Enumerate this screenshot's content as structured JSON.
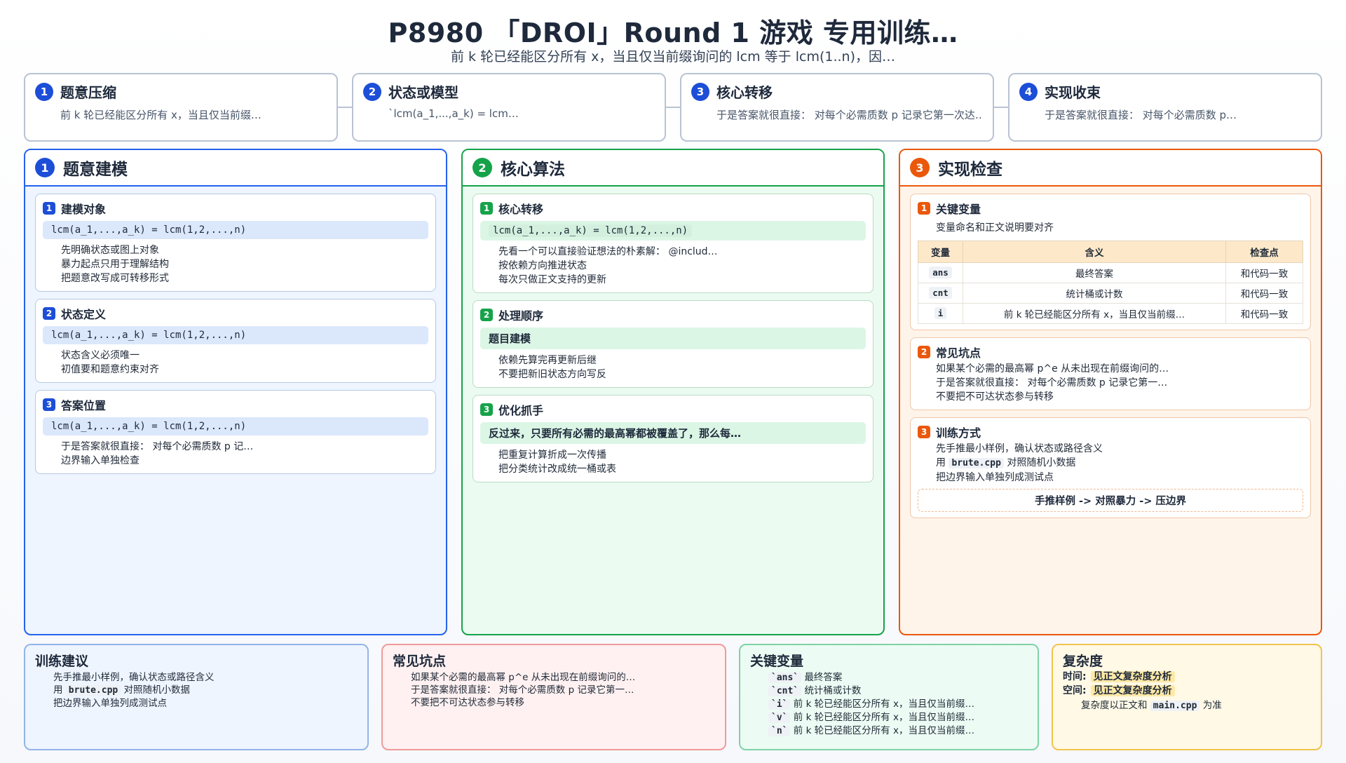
{
  "header": {
    "title": "P8980 「DROI」Round 1 游戏 专用训练…",
    "subtitle": "前 k 轮已经能区分所有 x，当且仅当前缀询问的 lcm 等于 lcm(1..n)，因…"
  },
  "steps": [
    {
      "num": "1",
      "title": "题意压缩",
      "desc": "前 k 轮已经能区分所有 x，当且仅当前缀…"
    },
    {
      "num": "2",
      "title": "状态或模型",
      "desc": "`lcm(a_1,...,a_k) = lcm…"
    },
    {
      "num": "3",
      "title": "核心转移",
      "desc": "于是答案就很直接：  对每个必需质数 p 记录它第一次达…"
    },
    {
      "num": "4",
      "title": "实现收束",
      "desc": "于是答案就很直接：  对每个必需质数 p…"
    }
  ],
  "columns": {
    "modeling": {
      "num": "1",
      "title": "题意建模",
      "cards": [
        {
          "num": "1",
          "title": "建模对象",
          "code": "lcm(a_1,...,a_k) = lcm(1,2,...,n)",
          "bullets": [
            "先明确状态或图上对象",
            "暴力起点只用于理解结构",
            "把题意改写成可转移形式"
          ]
        },
        {
          "num": "2",
          "title": "状态定义",
          "code": "lcm(a_1,...,a_k) = lcm(1,2,...,n)",
          "bullets": [
            "状态含义必须唯一",
            "初值要和题意约束对齐"
          ]
        },
        {
          "num": "3",
          "title": "答案位置",
          "code": "lcm(a_1,...,a_k) = lcm(1,2,...,n)",
          "bullets": [
            "于是答案就很直接：  对每个必需质数 p 记…",
            "边界输入单独检查"
          ]
        }
      ]
    },
    "algorithm": {
      "num": "2",
      "title": "核心算法",
      "cards": [
        {
          "num": "1",
          "title": "核心转移",
          "code": "lcm(a_1,...,a_k) = lcm(1,2,...,n)",
          "bullets": [
            "先看一个可以直接验证想法的朴素解：  @includ…",
            "按依赖方向推进状态",
            "每次只做正文支持的更新"
          ]
        },
        {
          "num": "2",
          "title": "处理顺序",
          "code": "题目建模",
          "bullets": [
            "依赖先算完再更新后继",
            "不要把新旧状态方向写反"
          ]
        },
        {
          "num": "3",
          "title": "优化抓手",
          "code": "反过来，只要所有必需的最高幂都被覆盖了，那么每…",
          "bullets": [
            "把重复计算折成一次传播",
            "把分类统计改成统一桶或表"
          ]
        }
      ]
    },
    "check": {
      "num": "3",
      "title": "实现检查",
      "vars_card": {
        "num": "1",
        "title": "关键变量",
        "bullet": "变量命名和正文说明要对齐",
        "headers": [
          "变量",
          "含义",
          "检查点"
        ],
        "rows": [
          [
            "ans",
            "最终答案",
            "和代码一致"
          ],
          [
            "cnt",
            "统计桶或计数",
            "和代码一致"
          ],
          [
            "i",
            "前 k 轮已经能区分所有 x，当且仅当前缀…",
            "和代码一致"
          ]
        ]
      },
      "pitfalls_card": {
        "num": "2",
        "title": "常见坑点",
        "bullets": [
          "如果某个必需的最高幂 p^e 从未出现在前缀询问的…",
          "于是答案就很直接：  对每个必需质数 p 记录它第一…",
          "不要把不可达状态参与转移"
        ]
      },
      "training_card": {
        "num": "3",
        "title": "训练方式",
        "bullet1": "先手推最小样例，确认状态或路径含义",
        "bullet2_pre": "用",
        "bullet2_code": "brute.cpp",
        "bullet2_post": "对照随机小数据",
        "bullet3": "把边界输入单独列成测试点",
        "flow": "手推样例 -> 对照暴力 -> 压边界"
      }
    }
  },
  "bottom": {
    "training": {
      "title": "训练建议",
      "b1": "先手推最小样例，确认状态或路径含义",
      "b2_pre": "用",
      "b2_code": "brute.cpp",
      "b2_post": "对照随机小数据",
      "b3": "把边界输入单独列成测试点"
    },
    "pitfalls": {
      "title": "常见坑点",
      "bullets": [
        "如果某个必需的最高幂 p^e 从未出现在前缀询问的…",
        "于是答案就很直接：  对每个必需质数 p 记录它第一…",
        "不要把不可达状态参与转移"
      ]
    },
    "vars": {
      "title": "关键变量",
      "items": [
        {
          "code": "`ans`",
          "text": "最终答案"
        },
        {
          "code": "`cnt`",
          "text": "统计桶或计数"
        },
        {
          "code": "`i`",
          "text": "前 k 轮已经能区分所有 x，当且仅当前缀…"
        },
        {
          "code": "`v`",
          "text": "前 k 轮已经能区分所有 x，当且仅当前缀…"
        },
        {
          "code": "`n`",
          "text": "前 k 轮已经能区分所有 x，当且仅当前缀…"
        }
      ]
    },
    "complexity": {
      "title": "复杂度",
      "time_label": "时间:",
      "time_value": "见正文复杂度分析",
      "space_label": "空间:",
      "space_value": "见正文复杂度分析",
      "note_pre": "复杂度以正文和",
      "note_code": "main.cpp",
      "note_post": "为准"
    }
  }
}
